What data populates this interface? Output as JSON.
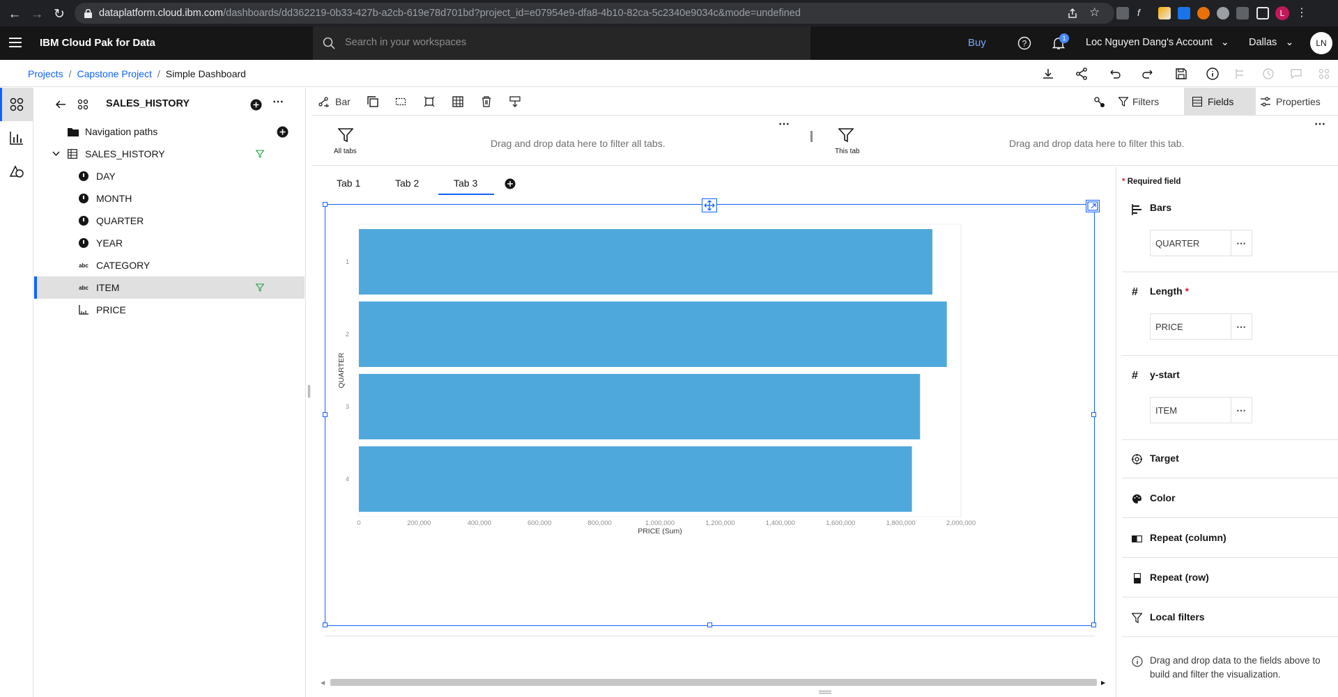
{
  "browser": {
    "url_host": "dataplatform.cloud.ibm.com",
    "url_path": "/dashboards/dd362219-0b33-427b-a2cb-619e78d701bd?project_id=e07954e9-dfa8-4b10-82ca-5c2340e9034c&mode=undefined",
    "profile_initial": "L"
  },
  "header": {
    "brand": "IBM Cloud Pak for Data",
    "search_placeholder": "Search in your workspaces",
    "buy": "Buy",
    "notifications": "1",
    "account": "Loc Nguyen Dang's Account",
    "region": "Dallas",
    "avatar": "LN"
  },
  "breadcrumb": [
    "Projects",
    "Capstone Project",
    "Simple Dashboard"
  ],
  "data_panel": {
    "title": "SALES_HISTORY",
    "tree": [
      {
        "label": "Navigation paths",
        "icon": "folder-icon"
      },
      {
        "label": "SALES_HISTORY",
        "icon": "table-icon"
      },
      {
        "label": "DAY",
        "icon": "time-icon"
      },
      {
        "label": "MONTH",
        "icon": "time-icon"
      },
      {
        "label": "QUARTER",
        "icon": "time-icon"
      },
      {
        "label": "YEAR",
        "icon": "time-icon"
      },
      {
        "label": "CATEGORY",
        "icon": "text-field-icon"
      },
      {
        "label": "ITEM",
        "icon": "text-field-icon"
      },
      {
        "label": "PRICE",
        "icon": "measure-icon"
      }
    ],
    "abc": "abc"
  },
  "canvas": {
    "viz_type": "Bar",
    "filters_btn": "Filters",
    "fields_btn": "Fields",
    "properties_btn": "Properties",
    "drop_all": "Drag and drop data here to filter all tabs.",
    "drop_tab": "Drag and drop data here to filter this tab.",
    "all_tabs": "All tabs",
    "this_tab": "This tab",
    "tabs": [
      "Tab 1",
      "Tab 2",
      "Tab 3"
    ],
    "active_tab": "Tab 3"
  },
  "chart_data": {
    "type": "bar",
    "orientation": "horizontal",
    "categories": [
      "1",
      "2",
      "3",
      "4"
    ],
    "values": [
      1905000,
      1953000,
      1864000,
      1837000
    ],
    "xlabel": "PRICE (Sum)",
    "ylabel": "QUARTER",
    "xlim": [
      0,
      2000000
    ],
    "xticks": [
      "0",
      "200,000",
      "400,000",
      "600,000",
      "800,000",
      "1,000,000",
      "1,200,000",
      "1,400,000",
      "1,600,000",
      "1,800,000",
      "2,000,000"
    ],
    "color": "#4fa8dc"
  },
  "fields_panel": {
    "required": "Required field",
    "bars_title": "Bars",
    "bars_value": "QUARTER",
    "length_title": "Length",
    "length_value": "PRICE",
    "ystart_title": "y-start",
    "ystart_value": "ITEM",
    "target": "Target",
    "color": "Color",
    "repeat_col": "Repeat (column)",
    "repeat_row": "Repeat (row)",
    "local_filters": "Local filters",
    "hint": "Drag and drop data to the fields above to build and filter the visualization."
  }
}
